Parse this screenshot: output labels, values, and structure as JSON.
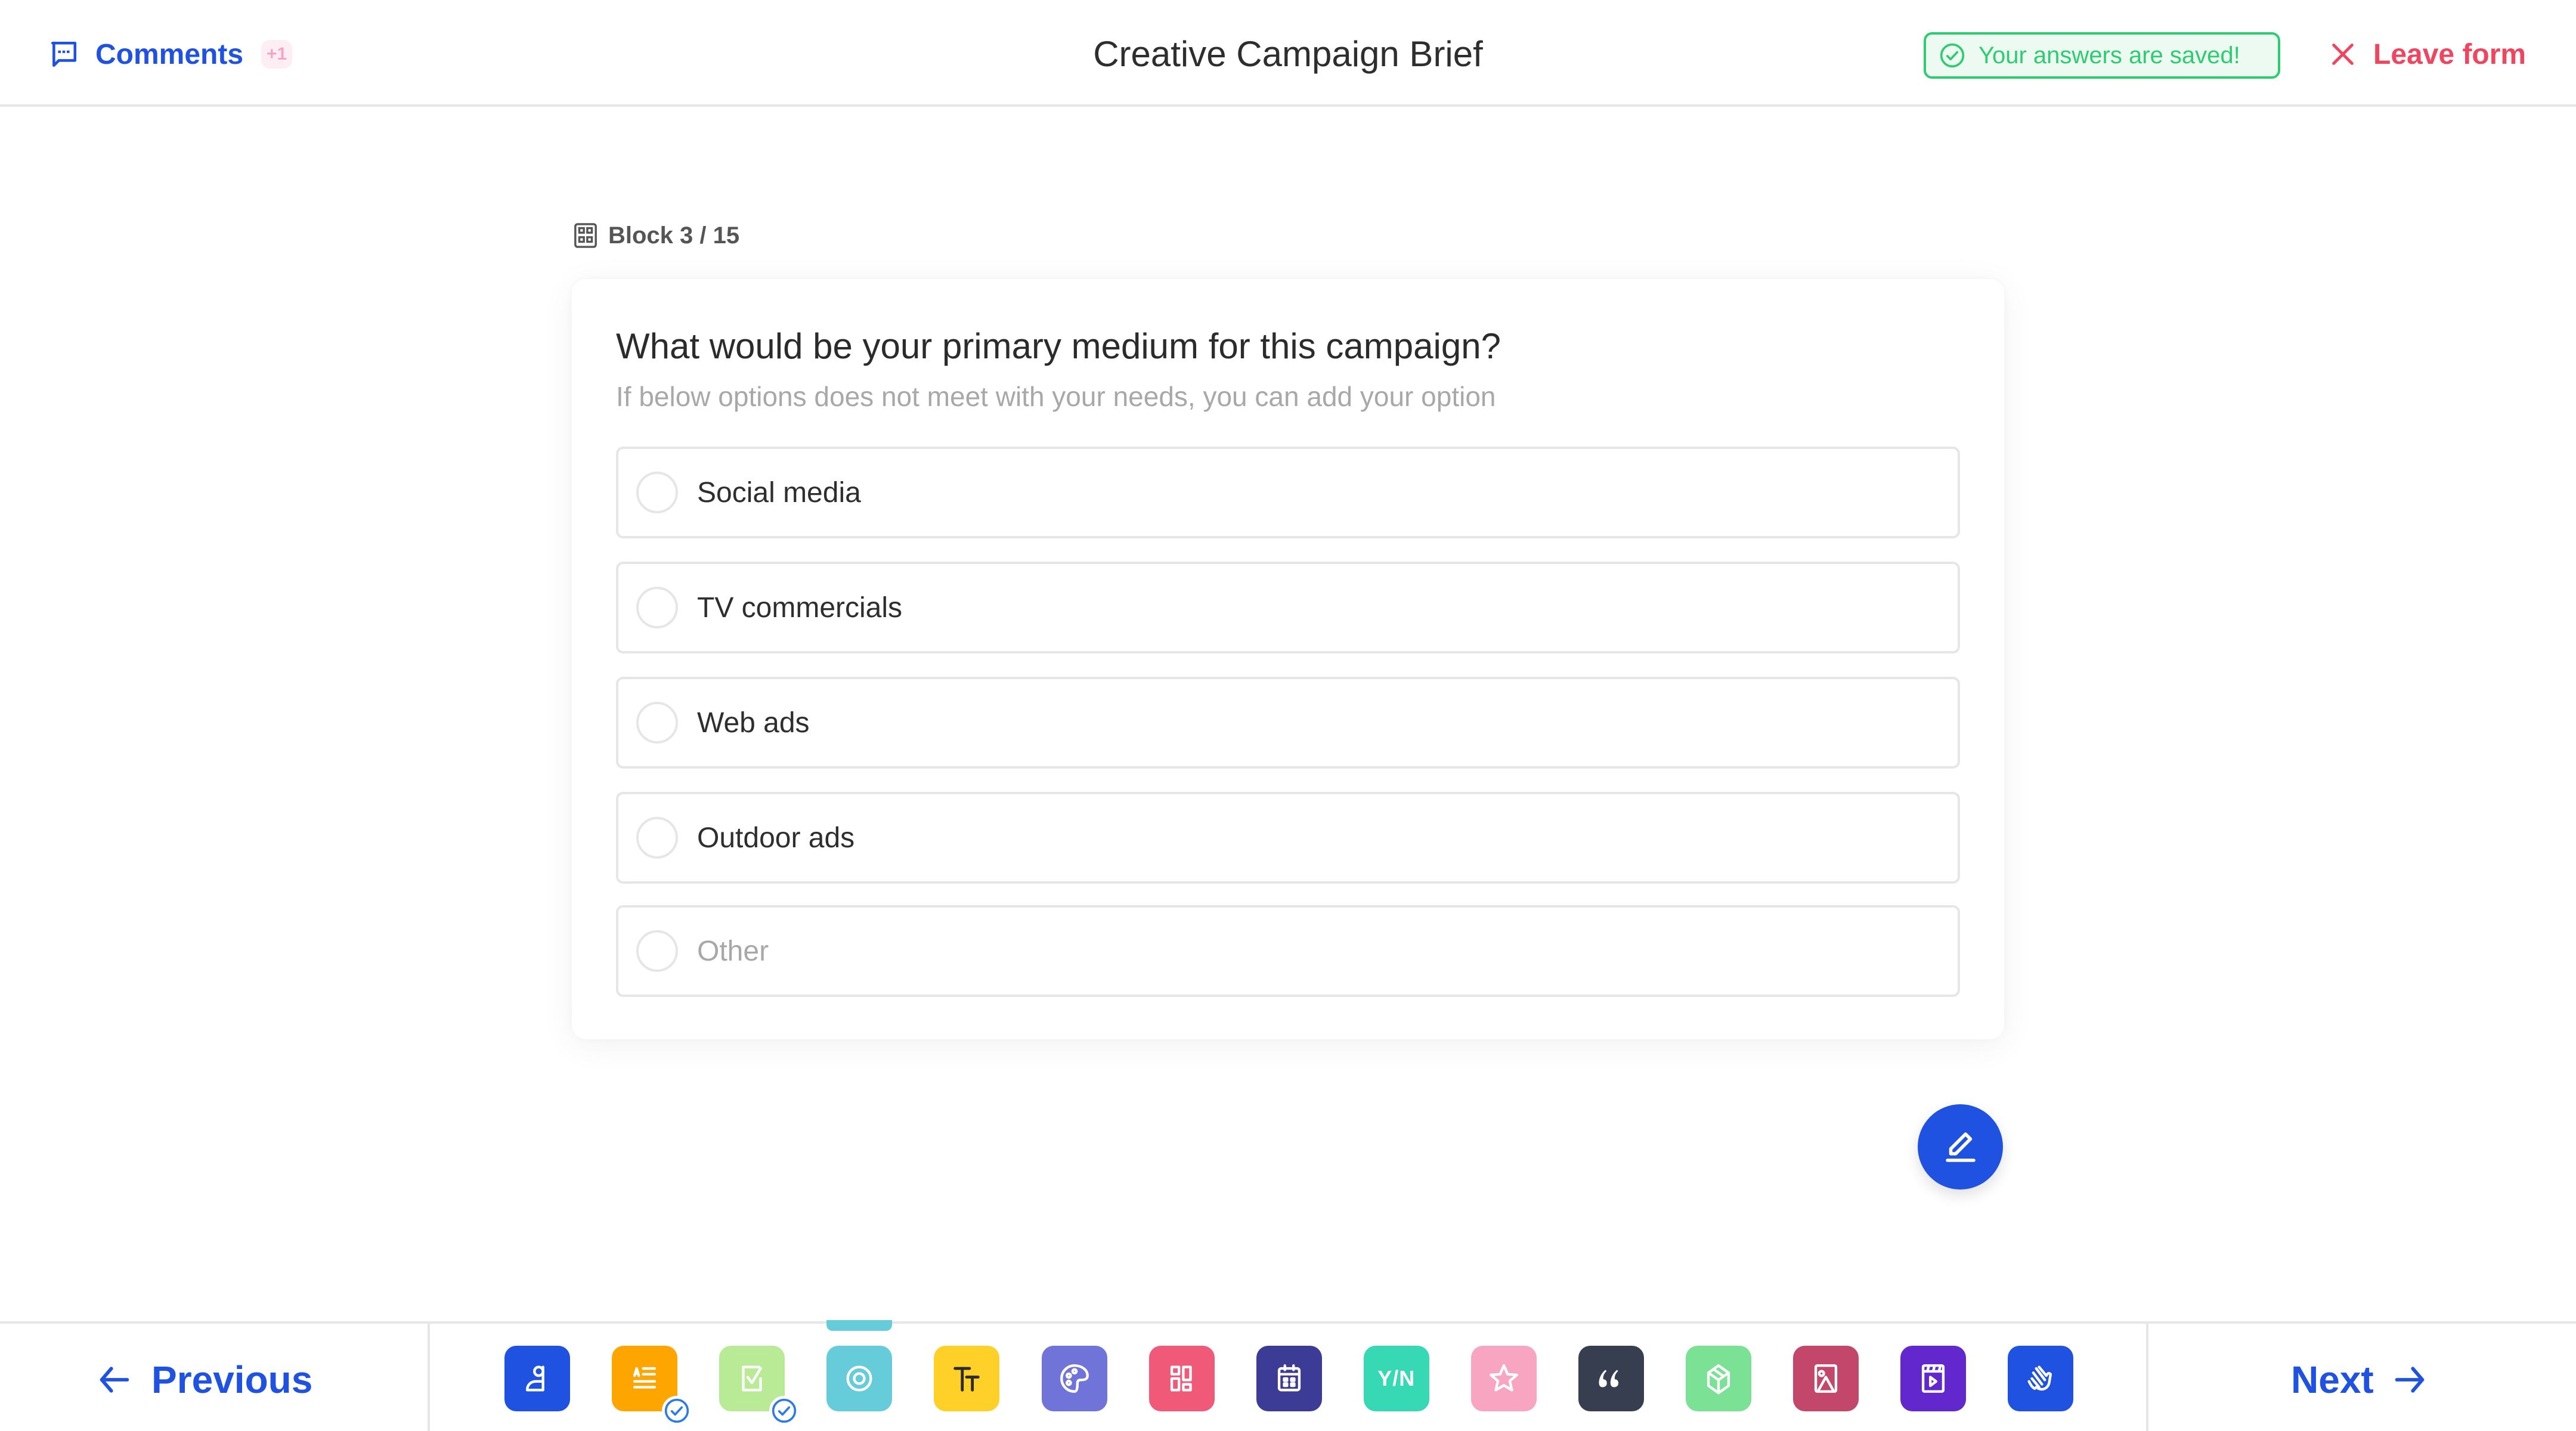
{
  "header": {
    "comments_label": "Comments",
    "comments_badge": "+1",
    "title": "Creative Campaign Brief",
    "saved_status": "Your answers are saved!",
    "leave_label": "Leave form"
  },
  "block": {
    "label": "Block 3 / 15",
    "current": 3,
    "total": 15
  },
  "question": {
    "title": "What would be your primary medium for this campaign?",
    "hint": "If below options does not meet with your needs, you can add your option",
    "options": [
      {
        "label": "Social media",
        "selected": false
      },
      {
        "label": "TV commercials",
        "selected": false
      },
      {
        "label": "Web ads",
        "selected": false
      },
      {
        "label": "Outdoor ads",
        "selected": false
      },
      {
        "label": "Other",
        "selected": false,
        "is_other_placeholder": true
      }
    ]
  },
  "fab": {
    "icon": "pencil-icon"
  },
  "footer": {
    "previous_label": "Previous",
    "next_label": "Next",
    "blocks": [
      {
        "icon": "welcome-user-icon",
        "color": "#1f52e0",
        "completed": false,
        "active": false
      },
      {
        "icon": "text-input-icon",
        "color": "#ffa500",
        "completed": true,
        "active": false
      },
      {
        "icon": "checkbox-icon",
        "color": "#b9eb96",
        "completed": true,
        "active": false
      },
      {
        "icon": "radio-target-icon",
        "color": "#67ccd9",
        "completed": false,
        "active": true
      },
      {
        "icon": "typography-icon",
        "color": "#ffd028",
        "completed": false,
        "active": false
      },
      {
        "icon": "palette-icon",
        "color": "#7073d7",
        "completed": false,
        "active": false
      },
      {
        "icon": "grid-icon",
        "color": "#f05a78",
        "completed": false,
        "active": false
      },
      {
        "icon": "calendar-icon",
        "color": "#3c3c96",
        "completed": false,
        "active": false
      },
      {
        "icon": "yes-no-icon",
        "label": "Y/N",
        "color": "#36d9b4",
        "completed": false,
        "active": false
      },
      {
        "icon": "star-icon",
        "color": "#f8a5c2",
        "completed": false,
        "active": false
      },
      {
        "icon": "quote-icon",
        "color": "#373e50",
        "completed": false,
        "active": false
      },
      {
        "icon": "box-icon",
        "color": "#7be195",
        "completed": false,
        "active": false
      },
      {
        "icon": "image-icon",
        "color": "#c3476b",
        "completed": false,
        "active": false
      },
      {
        "icon": "video-icon",
        "color": "#6228cd",
        "completed": false,
        "active": false
      },
      {
        "icon": "wave-hand-icon",
        "color": "#1f52e0",
        "completed": false,
        "active": false
      }
    ]
  },
  "colors": {
    "primary": "#1f52e0",
    "success": "#2ecc71",
    "danger": "#f0455f",
    "border": "#e6e6e6",
    "muted_text": "#a8a8a8"
  }
}
